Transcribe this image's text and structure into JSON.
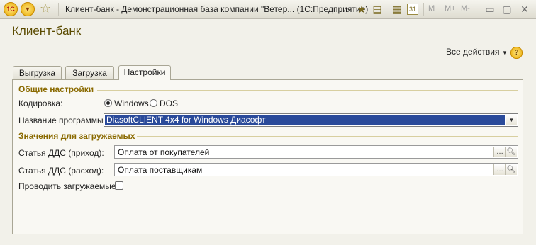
{
  "window": {
    "title": "Клиент-банк - Демонстрационная база компании \"Ветер... (1С:Предприятие)",
    "logo": "1С",
    "toolbar_icons": [
      "star-icon",
      "bookmark-icon",
      "document-icon",
      "calculator-icon",
      "calendar-icon"
    ],
    "calendar_day": "31",
    "memory_labels": [
      "M",
      "M+",
      "M-"
    ]
  },
  "page": {
    "title": "Клиент-банк",
    "all_actions": "Все действия",
    "help": "?"
  },
  "tabs": [
    {
      "label": "Выгрузка",
      "active": false
    },
    {
      "label": "Загрузка",
      "active": false
    },
    {
      "label": "Настройки",
      "active": true
    }
  ],
  "general": {
    "section_title": "Общие настройки",
    "encoding_label": "Кодировка:",
    "encoding_options": [
      "Windows",
      "DOS"
    ],
    "encoding_selected": "Windows",
    "program_label": "Название программы:",
    "program_value": "DiasoftCLIENT 4x4 for Windows Диасофт"
  },
  "import": {
    "section_title": "Значения для загружаемых",
    "income_label": "Статья ДДС (приход):",
    "income_value": "Оплата от покупателей",
    "expense_label": "Статья ДДС (расход):",
    "expense_value": "Оплата поставщикам",
    "post_label": "Проводить загружаемые:",
    "post_checked": false
  },
  "colors": {
    "accent": "#5a4a00",
    "section": "#8a6a00",
    "selection": "#2a4a9a"
  }
}
